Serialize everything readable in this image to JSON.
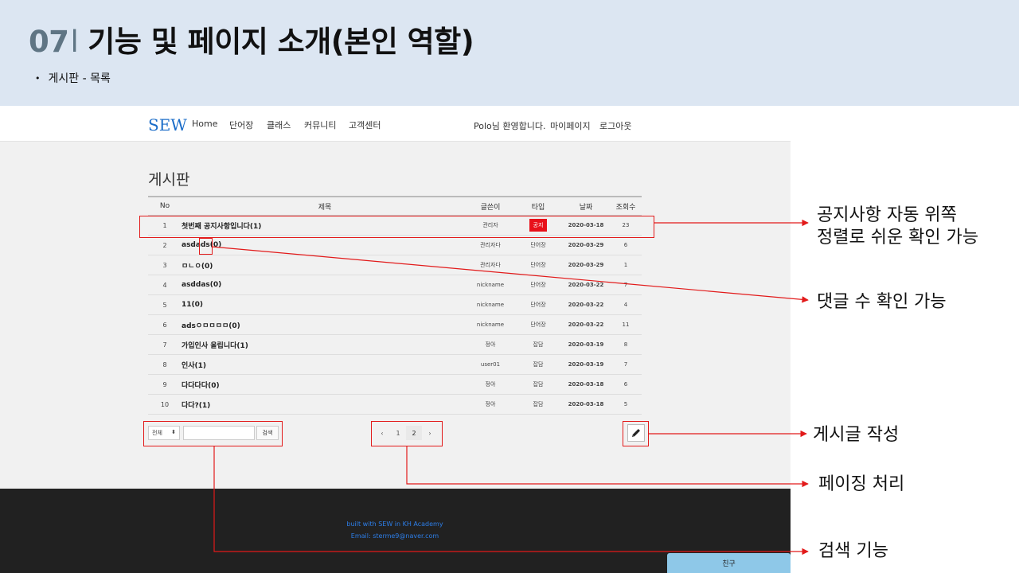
{
  "slide": {
    "number": "07",
    "separator": "l",
    "title": "기능 및 페이지 소개(본인 역할)",
    "bullet": "게시판 - 목록"
  },
  "site": {
    "brand": "SEW",
    "nav": [
      "Home",
      "단어장",
      "클래스",
      "커뮤니티",
      "고객센터"
    ],
    "welcome": "Polo님 환영합니다.",
    "mypage": "마이페이지",
    "logout": "로그아웃",
    "board_title": "게시판",
    "columns": {
      "no": "No",
      "title": "제목",
      "writer": "글쓴이",
      "type": "타입",
      "date": "날짜",
      "views": "조회수"
    },
    "rows": [
      {
        "no": "1",
        "title": "첫번째 공지사항입니다(1)",
        "writer": "관리자",
        "type": "공지",
        "date": "2020-03-18",
        "views": "23"
      },
      {
        "no": "2",
        "title": "asdads(0)",
        "writer": "관리자다",
        "type": "단어장",
        "date": "2020-03-29",
        "views": "6"
      },
      {
        "no": "3",
        "title": "ㅁㄴㅇ(0)",
        "writer": "관리자다",
        "type": "단어장",
        "date": "2020-03-29",
        "views": "1"
      },
      {
        "no": "4",
        "title": "asddas(0)",
        "writer": "nickname",
        "type": "단어장",
        "date": "2020-03-22",
        "views": "7"
      },
      {
        "no": "5",
        "title": "11(0)",
        "writer": "nickname",
        "type": "단어장",
        "date": "2020-03-22",
        "views": "4"
      },
      {
        "no": "6",
        "title": "adsㅇㅁㅁㅁㅁ(0)",
        "writer": "nickname",
        "type": "단어장",
        "date": "2020-03-22",
        "views": "11"
      },
      {
        "no": "7",
        "title": "가입인사 올립니다(1)",
        "writer": "정아",
        "type": "잡담",
        "date": "2020-03-19",
        "views": "8"
      },
      {
        "no": "8",
        "title": "인사(1)",
        "writer": "user01",
        "type": "잡담",
        "date": "2020-03-19",
        "views": "7"
      },
      {
        "no": "9",
        "title": "다다다다(0)",
        "writer": "정아",
        "type": "잡담",
        "date": "2020-03-18",
        "views": "6"
      },
      {
        "no": "10",
        "title": "다다?(1)",
        "writer": "정아",
        "type": "잡담",
        "date": "2020-03-18",
        "views": "5"
      }
    ],
    "search_option": "전체",
    "search_button": "검색",
    "pagination": {
      "prev": "‹",
      "pages": [
        "1",
        "2"
      ],
      "next": "›"
    },
    "write_icon": "pencil-icon",
    "footer_line1": "built with SEW in KH Academy",
    "footer_line2": "Email: sterme9@naver.com",
    "friend_tab": "친구"
  },
  "callouts": {
    "notice_line1": "공지사항 자동 위쪽",
    "notice_line2": "정렬로 쉬운 확인 가능",
    "comments": "댓글 수 확인 가능",
    "write": "게시글 작성",
    "paging": "페이징 처리",
    "search": "검색 기능"
  },
  "colors": {
    "header_bg": "#dce6f2",
    "title_number": "#5f7584",
    "brand": "#1a6cc8",
    "annotation": "#e21a1a",
    "notice_badge": "#e8111a",
    "footer_bg": "#212121",
    "friend_tab": "#8ec8e8"
  }
}
